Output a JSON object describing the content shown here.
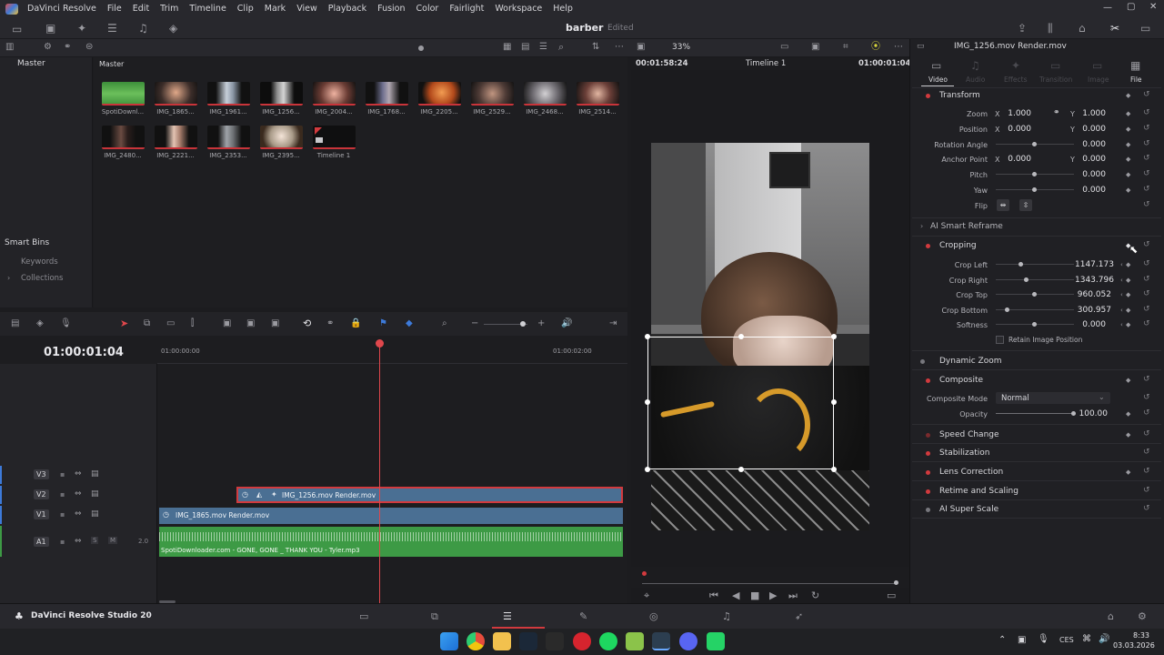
{
  "menubar": {
    "app_name": "DaVinci Resolve",
    "items": [
      "File",
      "Edit",
      "Trim",
      "Timeline",
      "Clip",
      "Mark",
      "View",
      "Playback",
      "Fusion",
      "Color",
      "Fairlight",
      "Workspace",
      "Help"
    ]
  },
  "project": {
    "name": "barber",
    "status": "Edited"
  },
  "viewer": {
    "zoom": "33%",
    "timecode_left": "00:01:58:24",
    "timeline_name": "Timeline 1",
    "timecode_right": "01:00:01:04"
  },
  "media_pool": {
    "bin_name": "Master",
    "bin_label": "Master",
    "smart_bins": "Smart Bins",
    "smart_bin_items": [
      "Keywords",
      "Collections"
    ],
    "clips": [
      "SpotiDownl...",
      "IMG_1865...",
      "IMG_1961...",
      "IMG_1256...",
      "IMG_2004...",
      "IMG_1768...",
      "IMG_2205...",
      "IMG_2529...",
      "IMG_2468...",
      "IMG_2514...",
      "IMG_2480...",
      "IMG_2221...",
      "IMG_2353...",
      "IMG_2395...",
      "Timeline 1"
    ]
  },
  "inspector": {
    "title": "IMG_1256.mov Render.mov",
    "tabs": [
      "Video",
      "Audio",
      "Effects",
      "Transition",
      "Image",
      "File"
    ],
    "transform": {
      "title": "Transform",
      "zoom_label": "Zoom",
      "zoom_x": "1.000",
      "zoom_y": "1.000",
      "position_label": "Position",
      "position_x": "0.000",
      "position_y": "0.000",
      "rotation_label": "Rotation Angle",
      "rotation": "0.000",
      "anchor_label": "Anchor Point",
      "anchor_x": "0.000",
      "anchor_y": "0.000",
      "pitch_label": "Pitch",
      "pitch": "0.000",
      "yaw_label": "Yaw",
      "yaw": "0.000",
      "flip_label": "Flip",
      "x": "X",
      "y": "Y"
    },
    "ai_reframe": "AI Smart Reframe",
    "cropping": {
      "title": "Cropping",
      "left_label": "Crop Left",
      "left": "1147.173",
      "right_label": "Crop Right",
      "right": "1343.796",
      "top_label": "Crop Top",
      "top": "960.052",
      "bottom_label": "Crop Bottom",
      "bottom": "300.957",
      "softness_label": "Softness",
      "softness": "0.000",
      "retain": "Retain Image Position"
    },
    "dynamic_zoom": "Dynamic Zoom",
    "composite": {
      "title": "Composite",
      "mode_label": "Composite Mode",
      "mode": "Normal",
      "opacity_label": "Opacity",
      "opacity": "100.00"
    },
    "sections": [
      "Speed Change",
      "Stabilization",
      "Lens Correction",
      "Retime and Scaling",
      "AI Super Scale"
    ]
  },
  "timeline": {
    "timecode": "01:00:01:04",
    "ruler": [
      "01:00:00:00",
      "01:00:02:00"
    ],
    "tracks": [
      "V3",
      "V2",
      "V1",
      "A1"
    ],
    "a1_level": "2.0",
    "solo": "S",
    "mute": "M",
    "clip_v2": "IMG_1256.mov Render.mov",
    "clip_v1": "IMG_1865.mov Render.mov",
    "clip_a1": "SpotiDownloader.com - GONE, GONE _ THANK YOU - Tyler.mp3"
  },
  "footer": {
    "brand": "DaVinci Resolve Studio 20"
  },
  "taskbar": {
    "lang": "CES",
    "time": "8:33",
    "date": "03.03.2026"
  },
  "colors": {
    "accent_red": "#d23a3e",
    "video_clip": "#4a6f93",
    "audio_clip": "#3d9a45"
  }
}
